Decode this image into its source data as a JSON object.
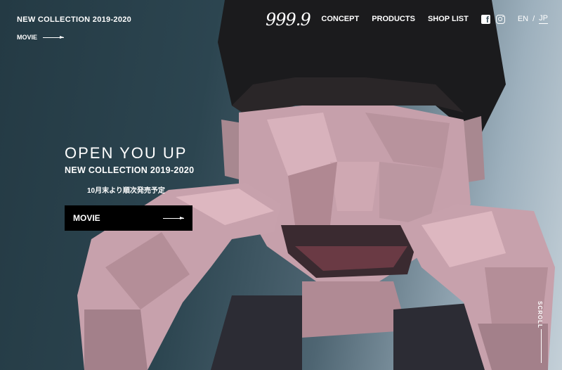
{
  "header": {
    "collection": "NEW COLLECTION 2019-2020",
    "movie_link": "MOVIE",
    "logo": "999.9",
    "nav": [
      "CONCEPT",
      "PRODUCTS",
      "SHOP LIST"
    ],
    "lang": {
      "en": "EN",
      "sep": "/",
      "jp": "JP"
    }
  },
  "hero": {
    "headline": "OPEN YOU UP",
    "subheadline": "NEW COLLECTION 2019-2020",
    "release": "10月末より順次発売予定",
    "button": "MOVIE"
  },
  "scroll": "SCROLL",
  "icons": {
    "facebook": "facebook-icon",
    "instagram": "instagram-icon"
  }
}
